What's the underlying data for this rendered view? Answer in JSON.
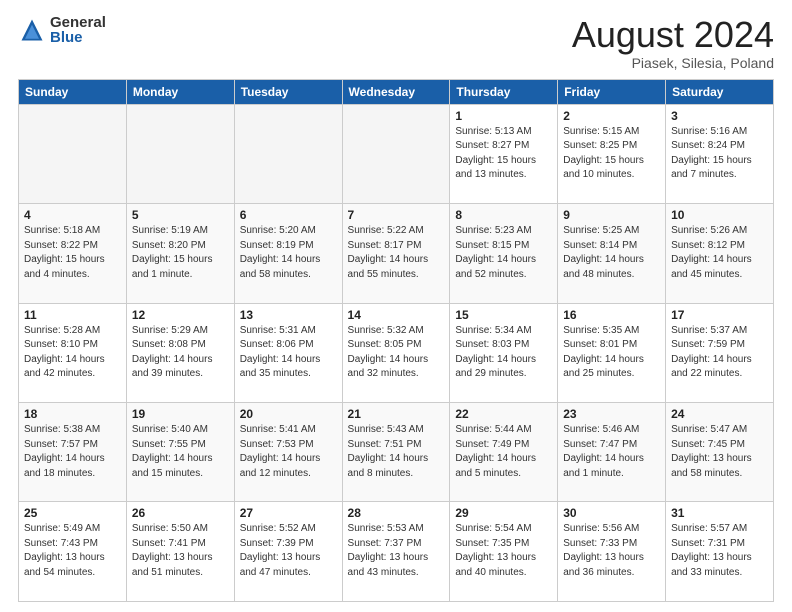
{
  "logo": {
    "general": "General",
    "blue": "Blue"
  },
  "title": "August 2024",
  "location": "Piasek, Silesia, Poland",
  "days_of_week": [
    "Sunday",
    "Monday",
    "Tuesday",
    "Wednesday",
    "Thursday",
    "Friday",
    "Saturday"
  ],
  "weeks": [
    [
      {
        "day": "",
        "info": ""
      },
      {
        "day": "",
        "info": ""
      },
      {
        "day": "",
        "info": ""
      },
      {
        "day": "",
        "info": ""
      },
      {
        "day": "1",
        "info": "Sunrise: 5:13 AM\nSunset: 8:27 PM\nDaylight: 15 hours\nand 13 minutes."
      },
      {
        "day": "2",
        "info": "Sunrise: 5:15 AM\nSunset: 8:25 PM\nDaylight: 15 hours\nand 10 minutes."
      },
      {
        "day": "3",
        "info": "Sunrise: 5:16 AM\nSunset: 8:24 PM\nDaylight: 15 hours\nand 7 minutes."
      }
    ],
    [
      {
        "day": "4",
        "info": "Sunrise: 5:18 AM\nSunset: 8:22 PM\nDaylight: 15 hours\nand 4 minutes."
      },
      {
        "day": "5",
        "info": "Sunrise: 5:19 AM\nSunset: 8:20 PM\nDaylight: 15 hours\nand 1 minute."
      },
      {
        "day": "6",
        "info": "Sunrise: 5:20 AM\nSunset: 8:19 PM\nDaylight: 14 hours\nand 58 minutes."
      },
      {
        "day": "7",
        "info": "Sunrise: 5:22 AM\nSunset: 8:17 PM\nDaylight: 14 hours\nand 55 minutes."
      },
      {
        "day": "8",
        "info": "Sunrise: 5:23 AM\nSunset: 8:15 PM\nDaylight: 14 hours\nand 52 minutes."
      },
      {
        "day": "9",
        "info": "Sunrise: 5:25 AM\nSunset: 8:14 PM\nDaylight: 14 hours\nand 48 minutes."
      },
      {
        "day": "10",
        "info": "Sunrise: 5:26 AM\nSunset: 8:12 PM\nDaylight: 14 hours\nand 45 minutes."
      }
    ],
    [
      {
        "day": "11",
        "info": "Sunrise: 5:28 AM\nSunset: 8:10 PM\nDaylight: 14 hours\nand 42 minutes."
      },
      {
        "day": "12",
        "info": "Sunrise: 5:29 AM\nSunset: 8:08 PM\nDaylight: 14 hours\nand 39 minutes."
      },
      {
        "day": "13",
        "info": "Sunrise: 5:31 AM\nSunset: 8:06 PM\nDaylight: 14 hours\nand 35 minutes."
      },
      {
        "day": "14",
        "info": "Sunrise: 5:32 AM\nSunset: 8:05 PM\nDaylight: 14 hours\nand 32 minutes."
      },
      {
        "day": "15",
        "info": "Sunrise: 5:34 AM\nSunset: 8:03 PM\nDaylight: 14 hours\nand 29 minutes."
      },
      {
        "day": "16",
        "info": "Sunrise: 5:35 AM\nSunset: 8:01 PM\nDaylight: 14 hours\nand 25 minutes."
      },
      {
        "day": "17",
        "info": "Sunrise: 5:37 AM\nSunset: 7:59 PM\nDaylight: 14 hours\nand 22 minutes."
      }
    ],
    [
      {
        "day": "18",
        "info": "Sunrise: 5:38 AM\nSunset: 7:57 PM\nDaylight: 14 hours\nand 18 minutes."
      },
      {
        "day": "19",
        "info": "Sunrise: 5:40 AM\nSunset: 7:55 PM\nDaylight: 14 hours\nand 15 minutes."
      },
      {
        "day": "20",
        "info": "Sunrise: 5:41 AM\nSunset: 7:53 PM\nDaylight: 14 hours\nand 12 minutes."
      },
      {
        "day": "21",
        "info": "Sunrise: 5:43 AM\nSunset: 7:51 PM\nDaylight: 14 hours\nand 8 minutes."
      },
      {
        "day": "22",
        "info": "Sunrise: 5:44 AM\nSunset: 7:49 PM\nDaylight: 14 hours\nand 5 minutes."
      },
      {
        "day": "23",
        "info": "Sunrise: 5:46 AM\nSunset: 7:47 PM\nDaylight: 14 hours\nand 1 minute."
      },
      {
        "day": "24",
        "info": "Sunrise: 5:47 AM\nSunset: 7:45 PM\nDaylight: 13 hours\nand 58 minutes."
      }
    ],
    [
      {
        "day": "25",
        "info": "Sunrise: 5:49 AM\nSunset: 7:43 PM\nDaylight: 13 hours\nand 54 minutes."
      },
      {
        "day": "26",
        "info": "Sunrise: 5:50 AM\nSunset: 7:41 PM\nDaylight: 13 hours\nand 51 minutes."
      },
      {
        "day": "27",
        "info": "Sunrise: 5:52 AM\nSunset: 7:39 PM\nDaylight: 13 hours\nand 47 minutes."
      },
      {
        "day": "28",
        "info": "Sunrise: 5:53 AM\nSunset: 7:37 PM\nDaylight: 13 hours\nand 43 minutes."
      },
      {
        "day": "29",
        "info": "Sunrise: 5:54 AM\nSunset: 7:35 PM\nDaylight: 13 hours\nand 40 minutes."
      },
      {
        "day": "30",
        "info": "Sunrise: 5:56 AM\nSunset: 7:33 PM\nDaylight: 13 hours\nand 36 minutes."
      },
      {
        "day": "31",
        "info": "Sunrise: 5:57 AM\nSunset: 7:31 PM\nDaylight: 13 hours\nand 33 minutes."
      }
    ]
  ]
}
